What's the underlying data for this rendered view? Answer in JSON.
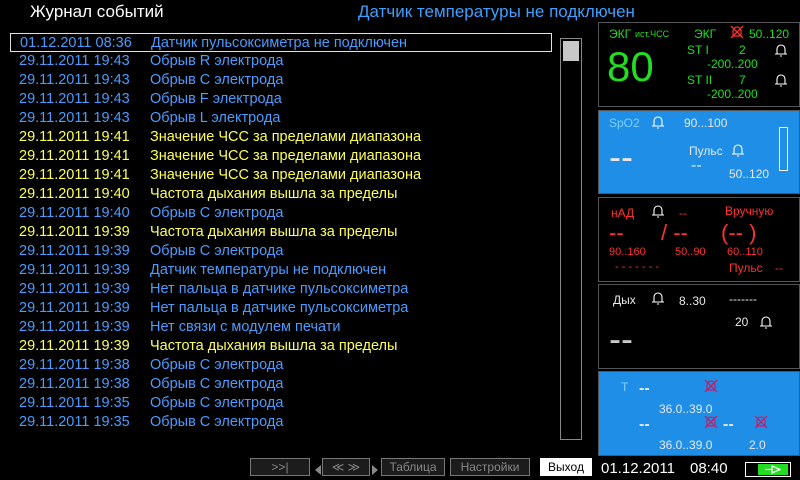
{
  "header": {
    "title": "Журнал событий",
    "alarm_message": "Датчик температуры не подключен"
  },
  "events": [
    {
      "datetime": "01.12.2011 08:36",
      "message": "Датчик пульсоксиметра не подключен",
      "color": "blue",
      "selected": true
    },
    {
      "datetime": "29.11.2011 19:43",
      "message": "Обрыв R электрода",
      "color": "blue"
    },
    {
      "datetime": "29.11.2011 19:43",
      "message": "Обрыв С электрода",
      "color": "blue"
    },
    {
      "datetime": "29.11.2011 19:43",
      "message": "Обрыв F электрода",
      "color": "blue"
    },
    {
      "datetime": "29.11.2011 19:43",
      "message": "Обрыв L электрода",
      "color": "blue"
    },
    {
      "datetime": "29.11.2011 19:41",
      "message": "Значение ЧСС за пределами диапазона",
      "color": "yellow"
    },
    {
      "datetime": "29.11.2011 19:41",
      "message": "Значение ЧСС за пределами диапазона",
      "color": "yellow"
    },
    {
      "datetime": "29.11.2011 19:41",
      "message": "Значение ЧСС за пределами диапазона",
      "color": "yellow"
    },
    {
      "datetime": "29.11.2011 19:40",
      "message": "Частота дыхания вышла за пределы",
      "color": "yellow"
    },
    {
      "datetime": "29.11.2011 19:40",
      "message": "Обрыв С электрода",
      "color": "blue"
    },
    {
      "datetime": "29.11.2011 19:39",
      "message": "Частота дыхания вышла за пределы",
      "color": "yellow"
    },
    {
      "datetime": "29.11.2011 19:39",
      "message": "Обрыв С электрода",
      "color": "blue"
    },
    {
      "datetime": "29.11.2011 19:39",
      "message": "Датчик температуры не подключен",
      "color": "blue"
    },
    {
      "datetime": "29.11.2011 19:39",
      "message": "Нет пальца в датчике пульсоксиметра",
      "color": "blue"
    },
    {
      "datetime": "29.11.2011 19:39",
      "message": "Нет пальца в датчике пульсоксиметра",
      "color": "blue"
    },
    {
      "datetime": "29.11.2011 19:39",
      "message": "Нет связи с модулем печати",
      "color": "blue"
    },
    {
      "datetime": "29.11.2011 19:39",
      "message": "Частота дыхания вышла за пределы",
      "color": "yellow"
    },
    {
      "datetime": "29.11.2011 19:38",
      "message": "Обрыв С электрода",
      "color": "blue"
    },
    {
      "datetime": "29.11.2011 19:38",
      "message": "Обрыв С электрода",
      "color": "blue"
    },
    {
      "datetime": "29.11.2011 19:35",
      "message": "Обрыв С электрода",
      "color": "blue"
    },
    {
      "datetime": "29.11.2011 19:35",
      "message": "Обрыв С электрода",
      "color": "blue"
    }
  ],
  "ecg": {
    "label": "ЭКГ",
    "source": "ист.ЧСС",
    "hr_value": "80",
    "label2": "ЭКГ",
    "hr_limits": "50..120",
    "st1_label": "ST I",
    "st1_value": "2",
    "st1_limits": "-200..200",
    "st2_label": "ST II",
    "st2_value": "7",
    "st2_limits": "-200..200"
  },
  "spo2": {
    "label": "SpO2",
    "limits": "90...100",
    "value": "--",
    "pulse_label": "Пульс",
    "pulse_value": "--",
    "pulse_limits": "50..120"
  },
  "nibp": {
    "label": "нАД",
    "status": "--",
    "mode": "Вручную",
    "sys": "--",
    "dia": "/ --",
    "mean": "(-- )",
    "sys_limits": "90..160",
    "dia_limits": "50..90",
    "mean_limits": "60..110",
    "time": "- - - - - - -",
    "pulse_label": "Пульс",
    "pulse_value": "--"
  },
  "resp": {
    "label": "Дых",
    "limits": "8..30",
    "dashes": "-------",
    "apnea_value": "20",
    "value": "--"
  },
  "temp": {
    "label": "T",
    "t1": "--",
    "t1_limits": "36.0..39.0",
    "t2": "--",
    "t2_limits": "36.0..39.0",
    "t3": "--",
    "dt_value": "2.0"
  },
  "toolbar": {
    "last_page": ">>|",
    "scroll": "≪ ≫",
    "table": "Таблица",
    "settings": "Настройки",
    "exit": "Выход"
  },
  "status": {
    "date": "01.12.2011",
    "time": "08:40"
  },
  "colors": {
    "blue_text": "#4a9cff",
    "yellow_text": "#ffff55",
    "green": "#22dd22",
    "red": "#ff3030",
    "panel_blue": "#1f8ee6"
  }
}
